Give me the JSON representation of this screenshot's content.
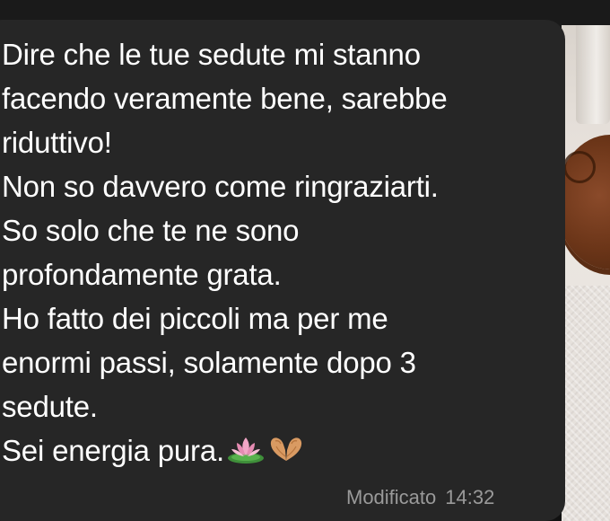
{
  "message": {
    "lines": [
      "Dire che le tue sedute mi stanno",
      "facendo veramente bene, sarebbe",
      "riduttivo!",
      "Non so davvero come ringraziarti.",
      "So solo che te ne sono",
      "profondamente grata.",
      "Ho fatto dei piccoli ma per me",
      "enormi passi, solamente dopo 3",
      "sedute.",
      "Sei energia pura."
    ],
    "emojis": [
      "lotus-icon",
      "heart-hands-icon"
    ],
    "edited_label": "Modificato",
    "time": "14:32"
  },
  "colors": {
    "background": "#111111",
    "bubble": "#262626",
    "text": "#ffffff",
    "meta": "#9a9a9a"
  }
}
